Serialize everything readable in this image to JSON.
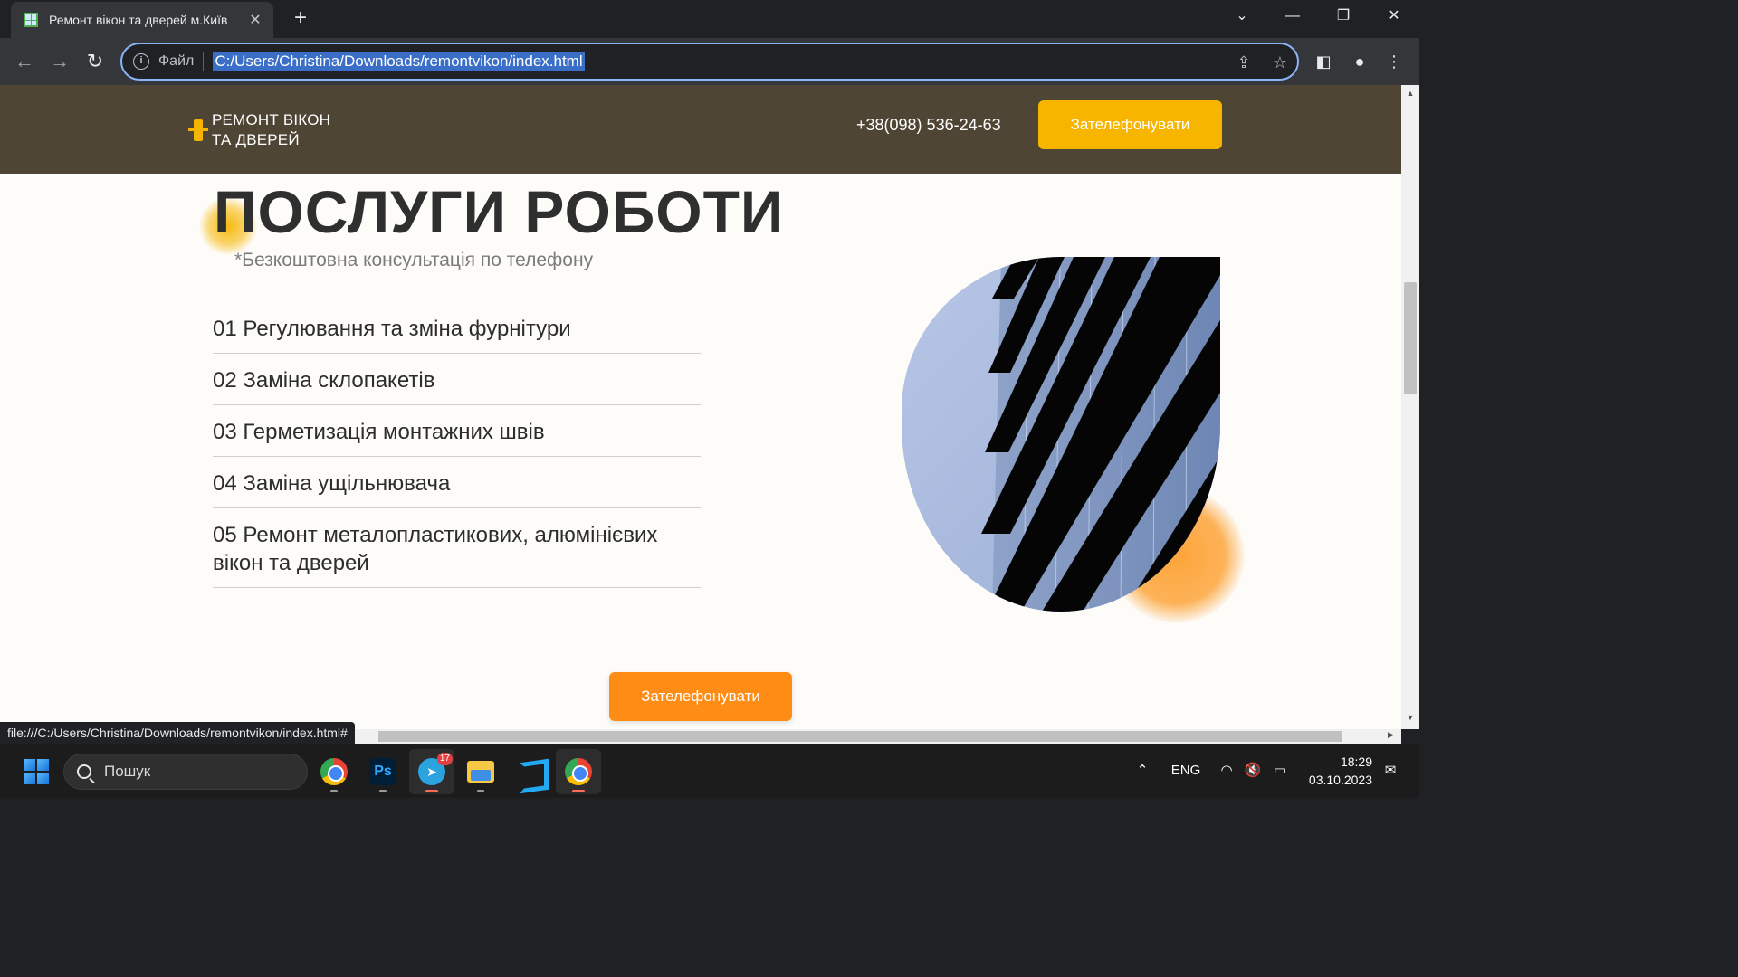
{
  "browser": {
    "tab_title": "Ремонт вікон та дверей м.Київ",
    "tab_close": "✕",
    "new_tab": "+",
    "scheme_label": "Файл",
    "url": "C:/Users/Christina/Downloads/remontvikon/index.html",
    "status_url": "file:///C:/Users/Christina/Downloads/remontvikon/index.html#"
  },
  "site": {
    "logo_line1": "РЕМОНТ ВІКОН",
    "logo_line2": "ТА ДВЕРЕЙ",
    "phone": "+38(098) 536-24-63",
    "header_call": "Зателефонувати",
    "section_title": "ПОСЛУГИ РОБОТИ",
    "subtitle": "*Безкоштовна консультація по телефону",
    "services": [
      "01 Регулювання та зміна фурнітури",
      "02 Заміна склопакетів",
      "03 Герметизація монтажних швів",
      "04 Заміна ущільнювача",
      "05 Ремонт металопластикових, алюмінієвих вікон та дверей"
    ],
    "main_call": "Зателефонувати",
    "colors": {
      "header_bg": "#4f4534",
      "accent_yellow": "#f7b500",
      "accent_orange": "#ff8c14"
    }
  },
  "taskbar": {
    "search_label": "Пошук",
    "telegram_badge": "17",
    "language": "ENG",
    "time": "18:29",
    "date": "03.10.2023"
  }
}
